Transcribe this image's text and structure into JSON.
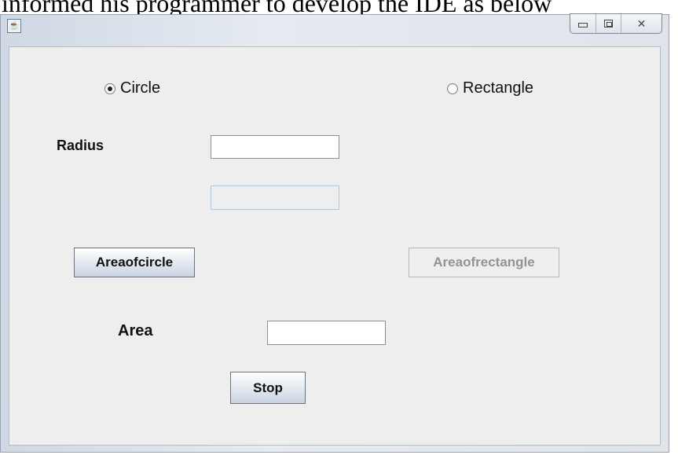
{
  "document": {
    "caption": "informed his programmer to develop the IDE as below"
  },
  "window": {
    "title": "",
    "icon": "java-icon",
    "controls": [
      "minimize-icon",
      "maximize-icon",
      "close-icon"
    ]
  },
  "form": {
    "circle_radio": {
      "label": "Circle",
      "selected": true
    },
    "rectangle_radio": {
      "label": "Rectangle",
      "selected": false
    },
    "radius_label": "Radius",
    "radius_value": "",
    "second_input_value": "",
    "area_circle_button": "Areaofcircle",
    "area_rectangle_button": "Areaofrectangle",
    "area_label": "Area",
    "area_value": "",
    "stop_button": "Stop"
  }
}
